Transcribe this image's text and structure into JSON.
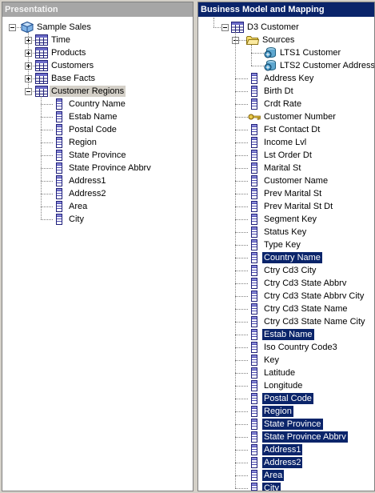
{
  "presentation": {
    "title": "Presentation",
    "root": "Sample Sales",
    "folders": [
      "Time",
      "Products",
      "Customers",
      "Base Facts",
      "Customer Regions"
    ],
    "columns": [
      "Country Name",
      "Estab Name",
      "Postal Code",
      "Region",
      "State Province",
      "State Province Abbrv",
      "Address1",
      "Address2",
      "Area",
      "City"
    ]
  },
  "bmm": {
    "title": "Business Model and Mapping",
    "table": "D3 Customer",
    "sources_label": "Sources",
    "sources": [
      "LTS1 Customer",
      "LTS2 Customer Address"
    ],
    "columns": [
      "Address Key",
      "Birth Dt",
      "Crdt Rate",
      "Customer Number",
      "Fst Contact Dt",
      "Income Lvl",
      "Lst Order Dt",
      "Marital St",
      "Customer Name",
      "Prev Marital St",
      "Prev Marital St Dt",
      "Segment Key",
      "Status Key",
      "Type Key",
      "Country Name",
      "Ctry Cd3 City",
      "Ctry Cd3 State Abbrv",
      "Ctry Cd3 State Abbrv City",
      "Ctry Cd3 State Name",
      "Ctry Cd3 State Name City",
      "Estab Name",
      "Iso Country Code3",
      "Key",
      "Latitude",
      "Longitude",
      "Postal Code",
      "Region",
      "State Province",
      "State Province Abbrv",
      "Address1",
      "Address2",
      "Area",
      "City"
    ],
    "key_column": "Customer Number",
    "selected_columns": [
      "Country Name",
      "Estab Name",
      "Postal Code",
      "Region",
      "State Province",
      "State Province Abbrv",
      "Address1",
      "Address2",
      "Area",
      "City"
    ]
  },
  "colors": {
    "selection": "#0a246a",
    "active_header": "#0a246a",
    "inactive_header": "#a6a6a6",
    "panel_bg": "#d4d0c8"
  },
  "icons": {
    "root": "presentation-catalog-icon",
    "folder": "presentation-table-icon",
    "column": "column-icon",
    "table": "logical-table-icon",
    "sources": "folder-icon",
    "source": "logical-table-source-icon",
    "key": "key-icon"
  }
}
